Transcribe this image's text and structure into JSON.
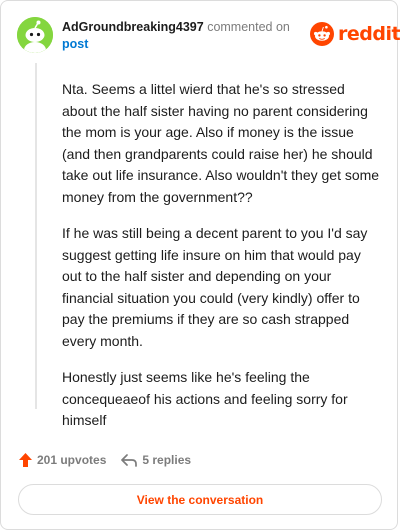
{
  "header": {
    "username": "AdGroundbreaking4397",
    "action_text": "commented on",
    "post_link": "post",
    "brand_text": "reddit"
  },
  "comment": {
    "paragraphs": [
      "Nta. Seems a littel wierd that he's so stressed about the half sister having no parent considering the mom is your age. Also if money is the issue (and then grandparents could raise her) he should take out life insurance. Also wouldn't they get some money from the government??",
      "If he was still being a decent parent to you I'd say suggest getting life insure on him that would pay out to the half sister and depending on your financial situation you could (very kindly) offer to pay the premiums if they are so cash strapped every month.",
      "Honestly just seems like he's feeling the concequeaeof his actions and feeling sorry for himself"
    ]
  },
  "footer": {
    "upvotes": "201 upvotes",
    "replies": "5 replies",
    "cta_label": "View the conversation"
  },
  "colors": {
    "brand": "#ff4500",
    "avatar": "#84d63f",
    "link": "#0079d3",
    "muted": "#7c7c7c"
  },
  "icons": {
    "avatar": "snoo-avatar-icon",
    "brand": "reddit-logo-icon",
    "upvote": "upvote-arrow-icon",
    "replies": "reply-arrow-icon"
  }
}
